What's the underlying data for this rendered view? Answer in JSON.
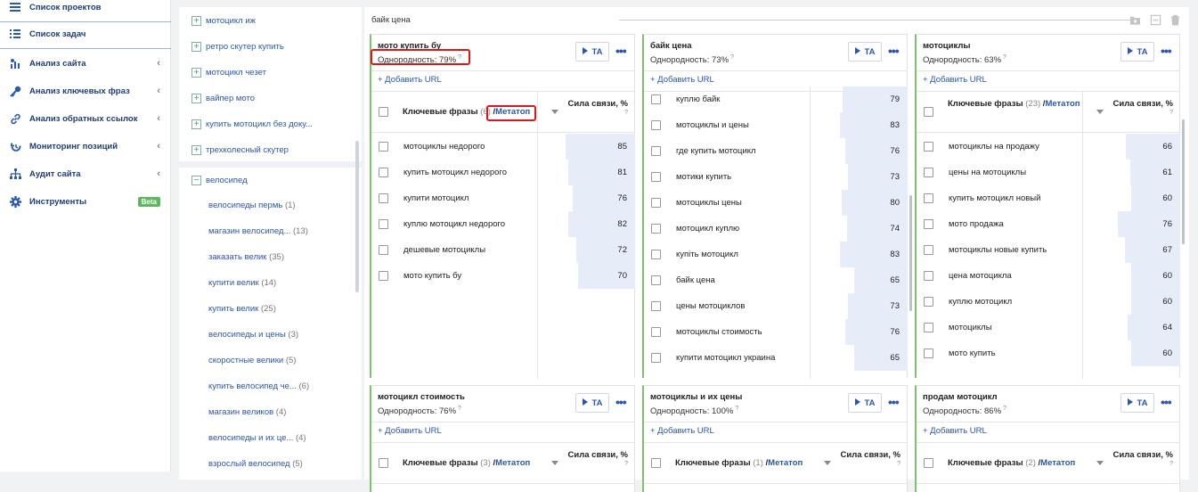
{
  "sidebar": {
    "items": [
      {
        "label": "Список проектов",
        "icon": "list-icon",
        "has_arrow": false
      },
      {
        "label": "Список задач",
        "icon": "task-list-icon",
        "has_arrow": false
      },
      {
        "label": "Анализ сайта",
        "icon": "analytics-icon",
        "has_arrow": true
      },
      {
        "label": "Анализ ключевых фраз",
        "icon": "key-icon",
        "has_arrow": true
      },
      {
        "label": "Анализ обратных ссылок",
        "icon": "link-icon",
        "has_arrow": true
      },
      {
        "label": "Мониторинг позиций",
        "icon": "history-icon",
        "has_arrow": true
      },
      {
        "label": "Аудит сайта",
        "icon": "sitemap-icon",
        "has_arrow": true
      },
      {
        "label": "Инструменты",
        "icon": "gear-icon",
        "has_arrow": false,
        "badge": "Beta"
      }
    ]
  },
  "tree": {
    "groups": [
      {
        "label": "мотоцикл иж",
        "sign": "+"
      },
      {
        "label": "ретро скутер купить",
        "sign": "+"
      },
      {
        "label": "мотоцикл чезет",
        "sign": "+"
      },
      {
        "label": "вайпер мото",
        "sign": "+"
      },
      {
        "label": "купить мотоцикл без доку...",
        "sign": "+"
      },
      {
        "label": "трехколесный скутер",
        "sign": "+"
      }
    ],
    "expanded": {
      "label": "велосипед",
      "sign": "−"
    },
    "children": [
      {
        "label": "велосипеды пермь",
        "count": "(1)"
      },
      {
        "label": "магазин велосипед...",
        "count": "(13)"
      },
      {
        "label": "заказать велик",
        "count": "(35)"
      },
      {
        "label": "купити велик",
        "count": "(14)"
      },
      {
        "label": "купить велик",
        "count": "(25)"
      },
      {
        "label": "велосипеды и цены",
        "count": "(3)"
      },
      {
        "label": "скоростные велики",
        "count": "(5)"
      },
      {
        "label": "купить велосипед че...",
        "count": "(6)"
      },
      {
        "label": "магазин великов",
        "count": "(4)"
      },
      {
        "label": "велосипеды и их це...",
        "count": "(4)"
      },
      {
        "label": "взрослый велосипед",
        "count": "(5)"
      }
    ]
  },
  "main": {
    "header_title": "байк цена",
    "labels": {
      "ta": "TA",
      "add_url": "+ Добавить URL",
      "keywords": "Ключевые фразы",
      "metatop": "Метатоп",
      "force": "Сила связи, %",
      "q": "?",
      "homogeneity": "Однородность:"
    },
    "cards": [
      {
        "title": "мото купить бу",
        "homogeneity": "79%",
        "count": "(6)",
        "rows": [
          {
            "kw": "мотоциклы недорого",
            "val": 85
          },
          {
            "kw": "купить мотоцикл недорого",
            "val": 81
          },
          {
            "kw": "купити мотоцикл",
            "val": 76
          },
          {
            "kw": "куплю мотоцикл недорого",
            "val": 82
          },
          {
            "kw": "дешевые мотоциклы",
            "val": 72
          },
          {
            "kw": "мото купить бу",
            "val": 70
          }
        ]
      },
      {
        "title": "байк цена",
        "homogeneity": "73%",
        "count": "",
        "rows": [
          {
            "kw": "куплю байк",
            "val": 79
          },
          {
            "kw": "мотоциклы и цены",
            "val": 83
          },
          {
            "kw": "где купить мотоцикл",
            "val": 76
          },
          {
            "kw": "мотики купить",
            "val": 73
          },
          {
            "kw": "мотоциклы цены",
            "val": 80
          },
          {
            "kw": "мотоцикл куплю",
            "val": 74
          },
          {
            "kw": "купіть мотоцикл",
            "val": 83
          },
          {
            "kw": "байк цена",
            "val": 65
          },
          {
            "kw": "цены мотоциклов",
            "val": 73
          },
          {
            "kw": "мотоциклы стоимость",
            "val": 76
          },
          {
            "kw": "купити мотоцикл украина",
            "val": 65
          }
        ]
      },
      {
        "title": "мотоциклы",
        "homogeneity": "63%",
        "count": "(23)",
        "rows": [
          {
            "kw": "мотоциклы на продажу",
            "val": 66
          },
          {
            "kw": "цены на мотоциклы",
            "val": 61
          },
          {
            "kw": "купить мотоцикл новый",
            "val": 60
          },
          {
            "kw": "мото продажа",
            "val": 76
          },
          {
            "kw": "мотоциклы новые купить",
            "val": 67
          },
          {
            "kw": "цена мотоцикла",
            "val": 60
          },
          {
            "kw": "куплю мотоцикл",
            "val": 60
          },
          {
            "kw": "мотоциклы",
            "val": 64
          },
          {
            "kw": "мото купить",
            "val": 60
          }
        ]
      },
      {
        "title": "мотоцикл стоимость",
        "homogeneity": "76%",
        "count": "(3)",
        "rows": []
      },
      {
        "title": "мотоциклы и их цены",
        "homogeneity": "100%",
        "count": "(1)",
        "rows": []
      },
      {
        "title": "продам мотоцикл",
        "homogeneity": "86%",
        "count": "(2)",
        "rows": []
      }
    ]
  },
  "colors": {
    "accent": "#2c56a8",
    "card_border": "#7cc46b",
    "highlight": "#e01515",
    "bar": "#e6ecf8"
  }
}
